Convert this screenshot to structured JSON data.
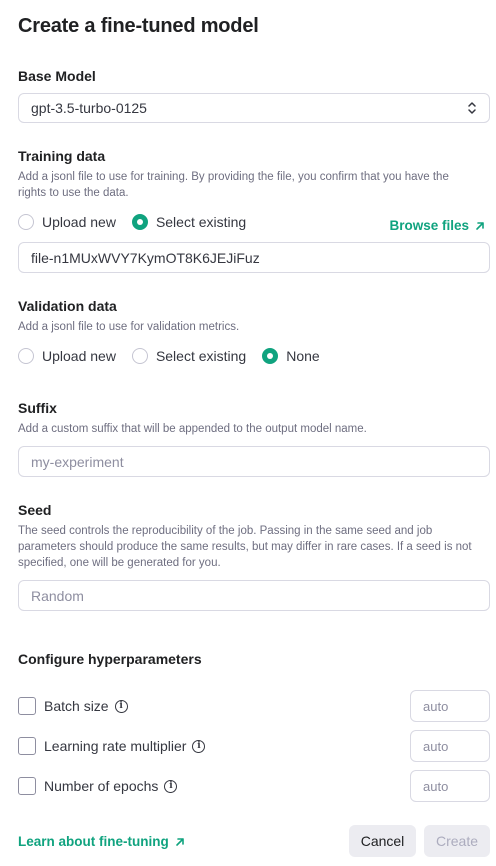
{
  "title": "Create a fine-tuned model",
  "base_model": {
    "label": "Base Model",
    "value": "gpt-3.5-turbo-0125"
  },
  "training": {
    "label": "Training data",
    "description": "Add a jsonl file to use for training. By providing the file, you confirm that you have the rights to use the data.",
    "option_upload": "Upload new",
    "option_select": "Select existing",
    "selected": "Select existing",
    "browse_label": "Browse files",
    "file_value": "file-n1MUxWVY7KymOT8K6JEJiFuz"
  },
  "validation": {
    "label": "Validation data",
    "description": "Add a jsonl file to use for validation metrics.",
    "option_upload": "Upload new",
    "option_select": "Select existing",
    "option_none": "None",
    "selected": "None"
  },
  "suffix": {
    "label": "Suffix",
    "description": "Add a custom suffix that will be appended to the output model name.",
    "placeholder": "my-experiment"
  },
  "seed": {
    "label": "Seed",
    "description": "The seed controls the reproducibility of the job. Passing in the same seed and job parameters should produce the same results, but may differ in rare cases. If a seed is not specified, one will be generated for you.",
    "placeholder": "Random"
  },
  "hyperparameters": {
    "label": "Configure hyperparameters",
    "items": [
      {
        "label": "Batch size",
        "placeholder": "auto",
        "checked": false
      },
      {
        "label": "Learning rate multiplier",
        "placeholder": "auto",
        "checked": false
      },
      {
        "label": "Number of epochs",
        "placeholder": "auto",
        "checked": false
      }
    ]
  },
  "footer": {
    "learn_link": "Learn about fine-tuning",
    "cancel_label": "Cancel",
    "create_label": "Create"
  },
  "colors": {
    "accent": "#10a37f",
    "border": "#d9d9e3",
    "muted_text": "#6e6e80"
  }
}
